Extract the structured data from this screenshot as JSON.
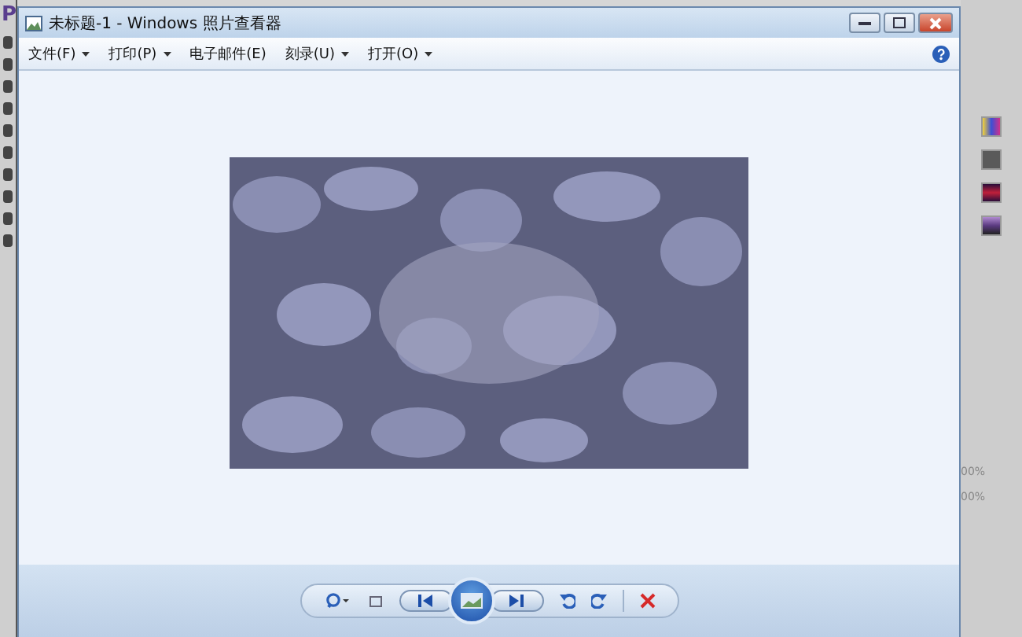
{
  "background_app": {
    "logo": "P",
    "panel_values": [
      "00%",
      "00%"
    ]
  },
  "window": {
    "title": "未标题-1 - Windows 照片查看器"
  },
  "menu": [
    {
      "label": "文件(F)",
      "has_dropdown": true
    },
    {
      "label": "打印(P)",
      "has_dropdown": true
    },
    {
      "label": "电子邮件(E)",
      "has_dropdown": false
    },
    {
      "label": "刻录(U)",
      "has_dropdown": true
    },
    {
      "label": "打开(O)",
      "has_dropdown": true
    }
  ]
}
